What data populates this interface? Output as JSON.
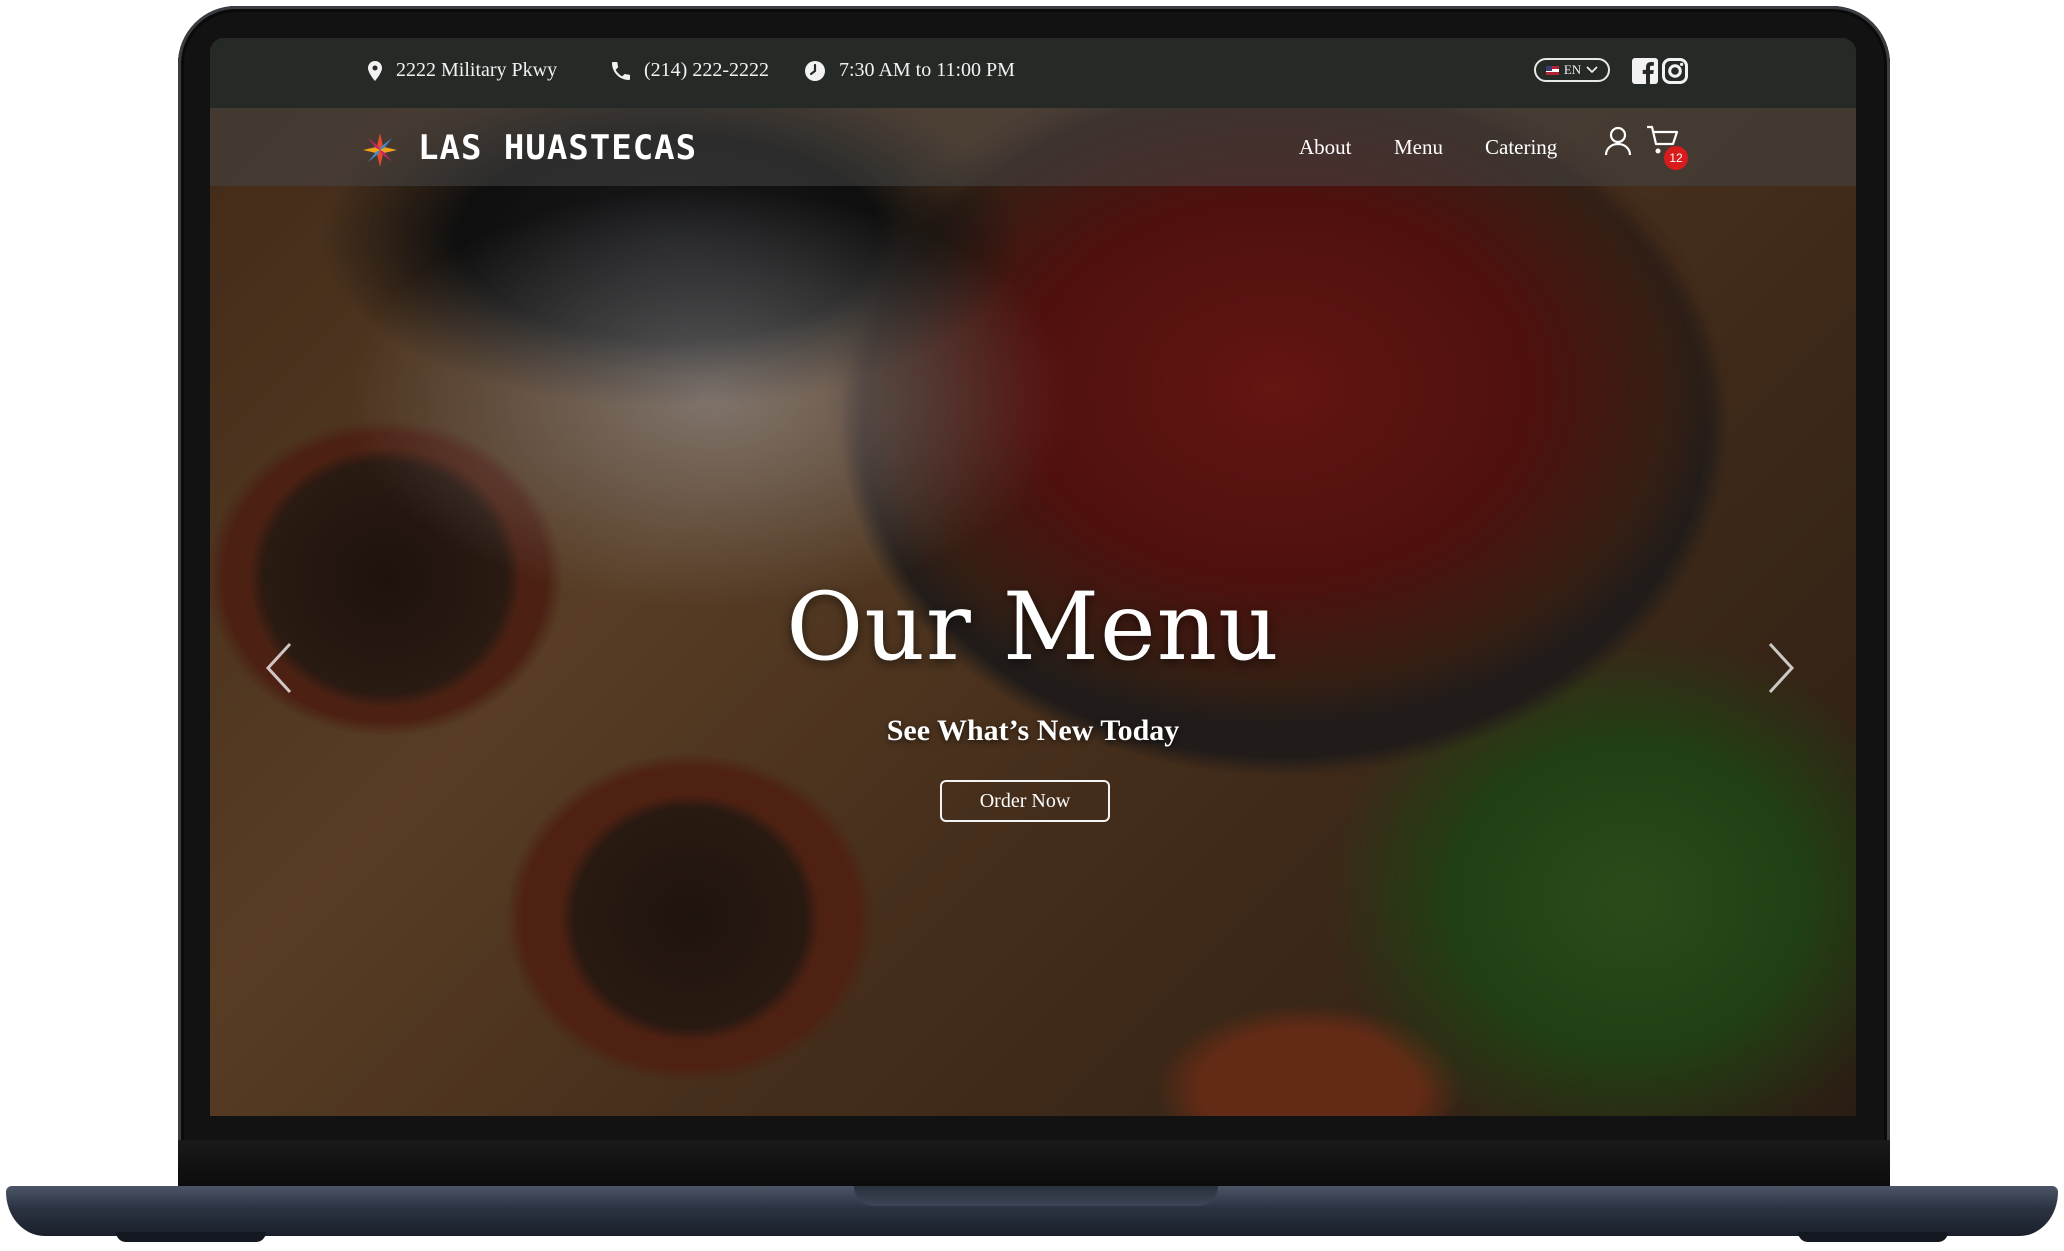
{
  "topbar": {
    "address": "2222 Military Pkwy",
    "phone": "(214) 222-2222",
    "hours": "7:30 AM to 11:00 PM",
    "language": "EN",
    "icons": [
      "map-pin-icon",
      "phone-icon",
      "clock-icon",
      "us-flag-icon",
      "chevron-down-icon",
      "facebook-icon",
      "instagram-icon"
    ]
  },
  "navbar": {
    "brand": "LAS HUASTECAS",
    "links": [
      "About",
      "Menu",
      "Catering"
    ],
    "cart_count": "12",
    "icons": [
      "logo-star-icon",
      "user-icon",
      "cart-icon"
    ]
  },
  "hero": {
    "title": "Our Menu",
    "subtitle": "See What’s New Today",
    "cta": "Order Now",
    "icons": [
      "chevron-left-icon",
      "chevron-right-icon"
    ]
  },
  "colors": {
    "topbar_bg": "#262a27",
    "cart_badge": "#d91b1b",
    "laptop_base": "#2b3342"
  }
}
